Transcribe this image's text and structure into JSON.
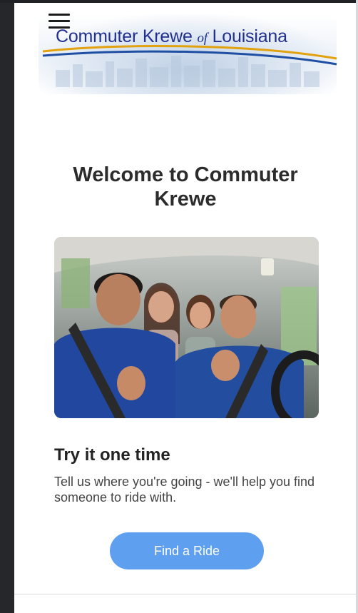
{
  "header": {
    "menu_icon": "hamburger-menu-icon",
    "logo": {
      "part1": "Commuter Krewe ",
      "of": "of",
      "part2": " Louisiana",
      "text_color": "#21308f",
      "swoosh_colors": [
        "#e2a20e",
        "#1f4fa3"
      ]
    }
  },
  "main": {
    "title": "Welcome to Commuter Krewe",
    "hero_image": "photo of smiling friends carpooling in a car giving thumbs up",
    "section_title": "Try it one time",
    "description": "Tell us where you're going - we'll help you find someone to ride with.",
    "cta_label": "Find a Ride",
    "cta_color": "#5f9ff0"
  }
}
